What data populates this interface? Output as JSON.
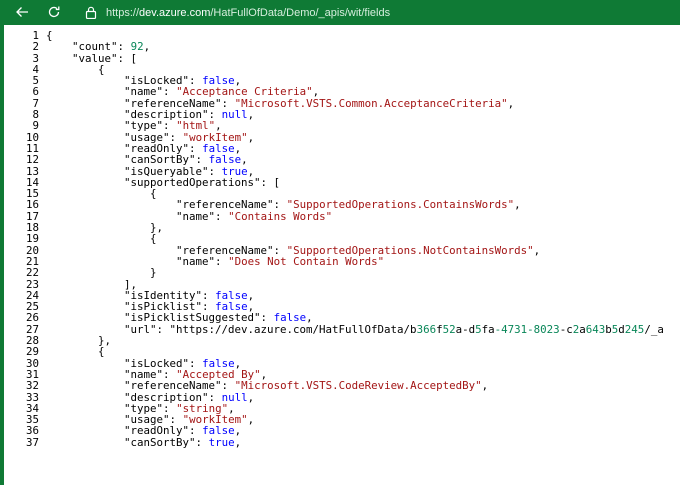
{
  "browser": {
    "back_label": "Back",
    "refresh_label": "Refresh",
    "url_base": "https://",
    "url_host": "dev.azure.com",
    "url_path": "/HatFullOfData/Demo/_apis/wit/fields",
    "colors": {
      "bar": "#0f7a35",
      "string": "#a31515",
      "keyword": "#0000ff",
      "number": "#098658"
    }
  },
  "json_viewer": {
    "lines": [
      {
        "n": "1",
        "t": "{"
      },
      {
        "n": "2",
        "t": "    \"count\": 92,"
      },
      {
        "n": "3",
        "t": "    \"value\": ["
      },
      {
        "n": "4",
        "t": "        {"
      },
      {
        "n": "5",
        "t": "            \"isLocked\": false,"
      },
      {
        "n": "6",
        "t": "            \"name\": \"Acceptance Criteria\","
      },
      {
        "n": "7",
        "t": "            \"referenceName\": \"Microsoft.VSTS.Common.AcceptanceCriteria\","
      },
      {
        "n": "8",
        "t": "            \"description\": null,"
      },
      {
        "n": "9",
        "t": "            \"type\": \"html\","
      },
      {
        "n": "10",
        "t": "            \"usage\": \"workItem\","
      },
      {
        "n": "11",
        "t": "            \"readOnly\": false,"
      },
      {
        "n": "12",
        "t": "            \"canSortBy\": false,"
      },
      {
        "n": "13",
        "t": "            \"isQueryable\": true,"
      },
      {
        "n": "14",
        "t": "            \"supportedOperations\": ["
      },
      {
        "n": "15",
        "t": "                {"
      },
      {
        "n": "16",
        "t": "                    \"referenceName\": \"SupportedOperations.ContainsWords\","
      },
      {
        "n": "17",
        "t": "                    \"name\": \"Contains Words\""
      },
      {
        "n": "18",
        "t": "                },"
      },
      {
        "n": "19",
        "t": "                {"
      },
      {
        "n": "20",
        "t": "                    \"referenceName\": \"SupportedOperations.NotContainsWords\","
      },
      {
        "n": "21",
        "t": "                    \"name\": \"Does Not Contain Words\""
      },
      {
        "n": "22",
        "t": "                }"
      },
      {
        "n": "23",
        "t": "            ],"
      },
      {
        "n": "24",
        "t": "            \"isIdentity\": false,"
      },
      {
        "n": "25",
        "t": "            \"isPicklist\": false,"
      },
      {
        "n": "26",
        "t": "            \"isPicklistSuggested\": false,"
      },
      {
        "n": "27",
        "t": "            \"url\": \"https://dev.azure.com/HatFullOfData/b366f52a-d5fa-4731-8023-c2a643b5d245/_a"
      },
      {
        "n": "28",
        "t": "        },"
      },
      {
        "n": "29",
        "t": "        {"
      },
      {
        "n": "30",
        "t": "            \"isLocked\": false,"
      },
      {
        "n": "31",
        "t": "            \"name\": \"Accepted By\","
      },
      {
        "n": "32",
        "t": "            \"referenceName\": \"Microsoft.VSTS.CodeReview.AcceptedBy\","
      },
      {
        "n": "33",
        "t": "            \"description\": null,"
      },
      {
        "n": "34",
        "t": "            \"type\": \"string\","
      },
      {
        "n": "35",
        "t": "            \"usage\": \"workItem\","
      },
      {
        "n": "36",
        "t": "            \"readOnly\": false,"
      },
      {
        "n": "37",
        "t": "            \"canSortBy\": true,"
      }
    ]
  }
}
